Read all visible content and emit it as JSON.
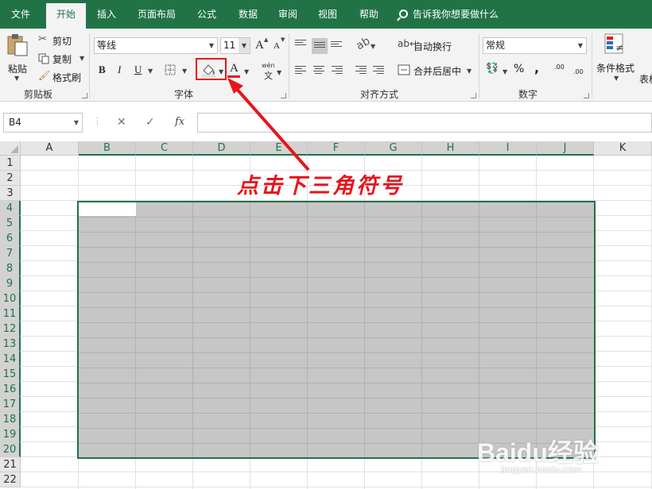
{
  "tabs": [
    "文件",
    "开始",
    "插入",
    "页面布局",
    "公式",
    "数据",
    "审阅",
    "视图",
    "帮助"
  ],
  "active_tab": "开始",
  "tell_me": "告诉我你想要做什么",
  "clipboard": {
    "paste": "粘贴",
    "cut": "剪切",
    "copy": "复制",
    "format_painter": "格式刷",
    "group": "剪贴板"
  },
  "font": {
    "name": "等线",
    "size": "11",
    "grow": "A",
    "shrink": "A",
    "bold": "B",
    "italic": "I",
    "underline": "U",
    "font_color": "A",
    "wen": "wén",
    "wen_char": "文",
    "group": "字体"
  },
  "alignment": {
    "wrap_text": "自动换行",
    "merge_center": "合并后居中",
    "group": "对齐方式"
  },
  "number": {
    "format": "常规",
    "percent": "%",
    "comma": ",",
    "inc_decimal": ".00",
    "dec_decimal": ".00",
    "group": "数字"
  },
  "styles": {
    "conditional_format": "条件格式",
    "table": "表格"
  },
  "name_box": "B4",
  "formula_icons": {
    "cancel": "✕",
    "enter": "✓",
    "fx": "fx"
  },
  "columns": [
    "A",
    "B",
    "C",
    "D",
    "E",
    "F",
    "G",
    "H",
    "I",
    "J",
    "K"
  ],
  "selected_columns": [
    "B",
    "C",
    "D",
    "E",
    "F",
    "G",
    "H",
    "I",
    "J"
  ],
  "rows": [
    "1",
    "2",
    "3",
    "4",
    "5",
    "6",
    "7",
    "8",
    "9",
    "10",
    "11",
    "12",
    "13",
    "14",
    "15",
    "16",
    "17",
    "18",
    "19",
    "20",
    "21",
    "22"
  ],
  "selected_rows": [
    "4",
    "5",
    "6",
    "7",
    "8",
    "9",
    "10",
    "11",
    "12",
    "13",
    "14",
    "15",
    "16",
    "17",
    "18",
    "19",
    "20"
  ],
  "annotation": "点击下三角符号",
  "watermark": "Baidu经验",
  "watermark_sub": "jingyan.baidu.com",
  "colors": {
    "brand": "#217346",
    "selection_fill": "#c6c6c6",
    "annotation_red": "#e8141c"
  }
}
